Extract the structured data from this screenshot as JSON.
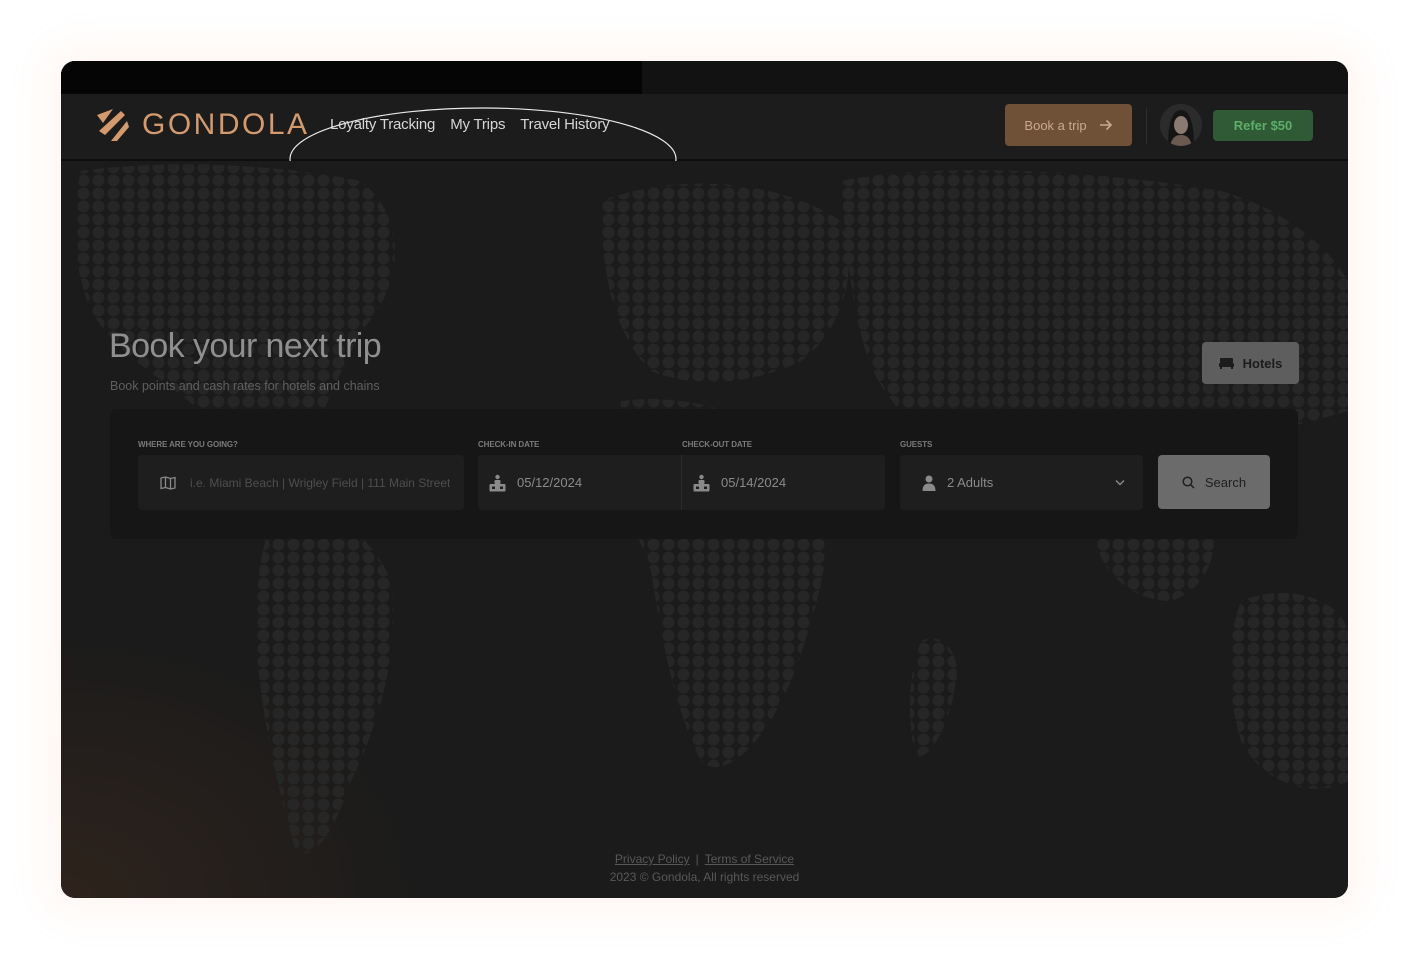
{
  "brand": {
    "name": "GONDOLA",
    "color": "#d49a6d"
  },
  "nav": {
    "links": [
      "Loyalty Tracking",
      "My Trips",
      "Travel History"
    ]
  },
  "header": {
    "book_label": "Book a trip",
    "refer_label": "Refer $50"
  },
  "hero": {
    "title": "Book your next trip",
    "subtitle": "Book points and cash rates for hotels and chains",
    "hotels_label": "Hotels"
  },
  "search": {
    "destination_label": "WHERE ARE YOU GOING?",
    "destination_placeholder": "i.e. Miami Beach | Wrigley Field | 111 Main Street",
    "checkin_label": "CHECK-IN DATE",
    "checkin_value": "05/12/2024",
    "checkout_label": "CHECK-OUT DATE",
    "checkout_value": "05/14/2024",
    "guests_label": "GUESTS",
    "guests_value": "2 Adults",
    "search_label": "Search"
  },
  "footer": {
    "privacy": "Privacy Policy",
    "separator": "|",
    "terms": "Terms of Service",
    "copyright": "2023 © Gondola, All rights reserved"
  }
}
